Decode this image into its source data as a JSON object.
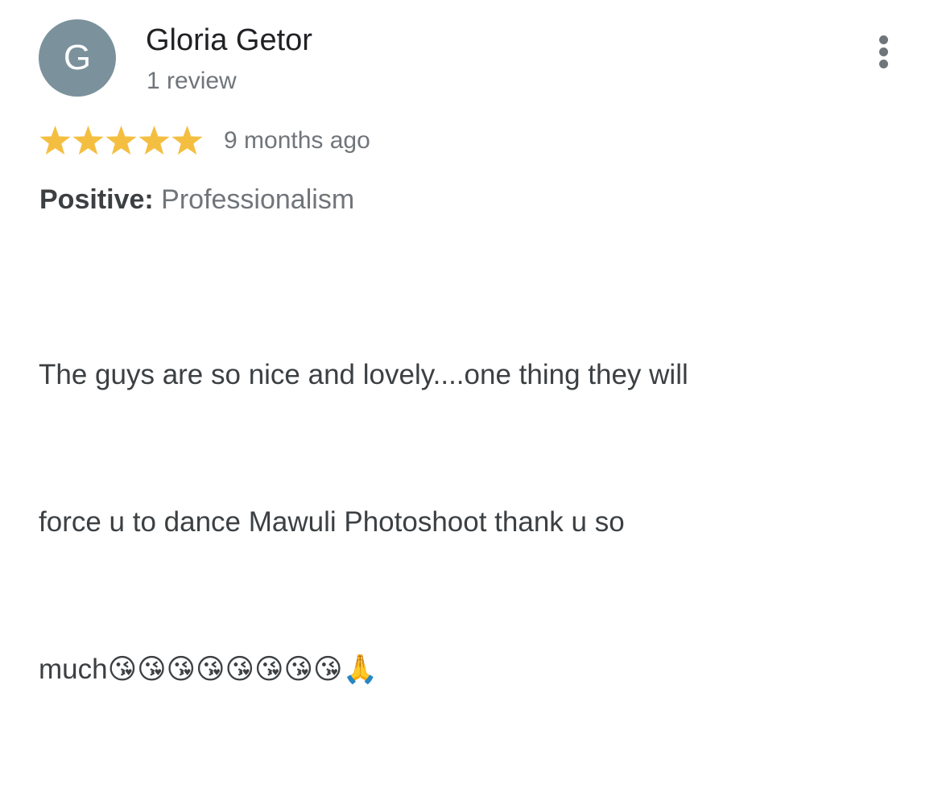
{
  "review": {
    "author": {
      "initial": "G",
      "name": "Gloria Getor",
      "meta": "1 review",
      "avatar_color": "#7b929d"
    },
    "rating": {
      "stars": 5,
      "max_stars": 5,
      "star_color": "#f4bf41",
      "timestamp": "9 months ago"
    },
    "attribute": {
      "label": "Positive:",
      "value": "Professionalism"
    },
    "text_lines": [
      "The guys are so nice and lovely....one thing they will",
      "force u to dance Mawuli Photoshoot thank u so",
      "much😘😘😘😘😘😘😘😘🙏"
    ],
    "menu_icon": "more-vertical-icon"
  }
}
